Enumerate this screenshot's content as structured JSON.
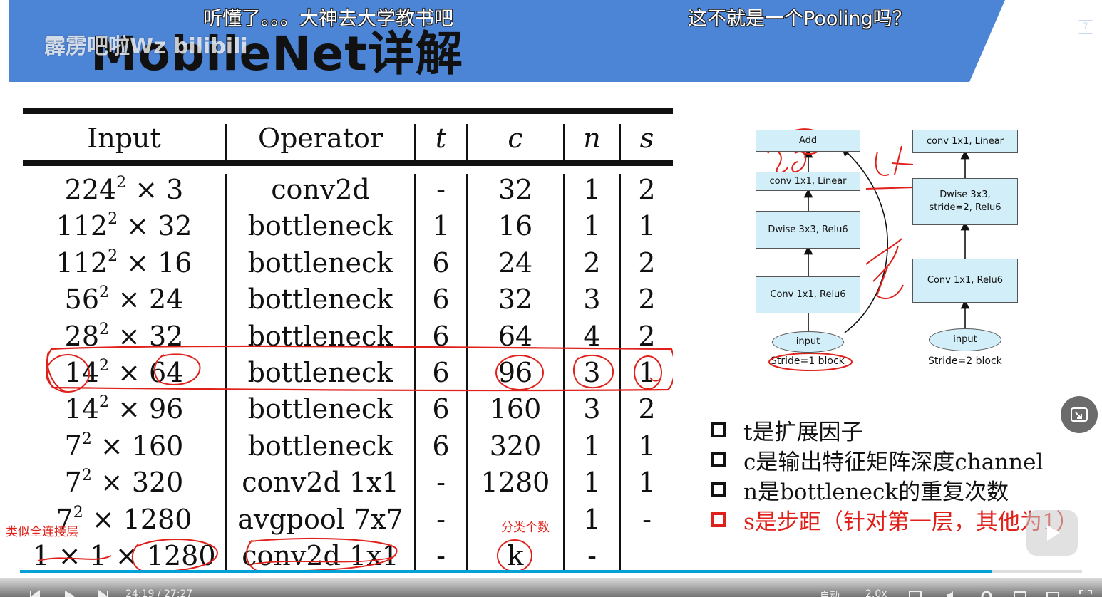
{
  "banner": {
    "title": "MobileNet详解",
    "watermark": "霹雳吧啦Wz bilibili",
    "danmaku": [
      "听懂了。。。大神去大学教书吧",
      "这不就是一个Pooling吗？"
    ],
    "help": "?",
    "color": "#4d85d6"
  },
  "table": {
    "headers": [
      "Input",
      "Operator",
      "t",
      "c",
      "n",
      "s"
    ],
    "rows": [
      {
        "in_base": "224",
        "in_exp": "2",
        "in_rest": " × 3",
        "op": "conv2d",
        "t": "-",
        "c": "32",
        "n": "1",
        "s": "2"
      },
      {
        "in_base": "112",
        "in_exp": "2",
        "in_rest": " × 32",
        "op": "bottleneck",
        "t": "1",
        "c": "16",
        "n": "1",
        "s": "1"
      },
      {
        "in_base": "112",
        "in_exp": "2",
        "in_rest": " × 16",
        "op": "bottleneck",
        "t": "6",
        "c": "24",
        "n": "2",
        "s": "2"
      },
      {
        "in_base": "56",
        "in_exp": "2",
        "in_rest": " × 24",
        "op": "bottleneck",
        "t": "6",
        "c": "32",
        "n": "3",
        "s": "2"
      },
      {
        "in_base": "28",
        "in_exp": "2",
        "in_rest": " × 32",
        "op": "bottleneck",
        "t": "6",
        "c": "64",
        "n": "4",
        "s": "2"
      },
      {
        "in_base": "14",
        "in_exp": "2",
        "in_rest": " × 64",
        "op": "bottleneck",
        "t": "6",
        "c": "96",
        "n": "3",
        "s": "1"
      },
      {
        "in_base": "14",
        "in_exp": "2",
        "in_rest": " × 96",
        "op": "bottleneck",
        "t": "6",
        "c": "160",
        "n": "3",
        "s": "2"
      },
      {
        "in_base": "7",
        "in_exp": "2",
        "in_rest": " × 160",
        "op": "bottleneck",
        "t": "6",
        "c": "320",
        "n": "1",
        "s": "1"
      },
      {
        "in_base": "7",
        "in_exp": "2",
        "in_rest": " × 320",
        "op": "conv2d 1x1",
        "t": "-",
        "c": "1280",
        "n": "1",
        "s": "1"
      },
      {
        "in_base": "7",
        "in_exp": "2",
        "in_rest": " × 1280",
        "op": "avgpool 7x7",
        "t": "-",
        "c": "",
        "n": "1",
        "s": "-"
      },
      {
        "in_base": "1 × 1",
        "in_exp": "",
        "in_rest": " × 1280",
        "op": "conv2d 1x1",
        "t": "-",
        "c": "k",
        "n": "-",
        "s": ""
      }
    ]
  },
  "notes": {
    "left": "类似全连接层",
    "middle": "分类个数",
    "handwritten": [
      "96",
      "64"
    ]
  },
  "diagram": {
    "stride1": {
      "add": "Add",
      "linear": "conv 1x1, Linear",
      "dwise": "Dwise 3x3, Relu6",
      "conv": "Conv 1x1, Relu6",
      "input": "input",
      "label": "Stride=1 block"
    },
    "stride2": {
      "linear": "conv 1x1, Linear",
      "dwise_line1": "Dwise 3x3,",
      "dwise_line2": "stride=2, Relu6",
      "conv": "Conv 1x1, Relu6",
      "input": "input",
      "label": "Stride=2 block"
    }
  },
  "legend": [
    {
      "text": "t是扩展因子",
      "color": "#111111"
    },
    {
      "text": "c是输出特征矩阵深度channel",
      "color": "#111111"
    },
    {
      "text": "n是bottleneck的重复次数",
      "color": "#111111"
    },
    {
      "text": "s是步距（针对第一层，其他为1）",
      "color": "#e0201a"
    }
  ],
  "player": {
    "progress": 0.915,
    "time": "24:19 / 27:27",
    "autoplay_label": "自动",
    "speed": "2.0x",
    "accent": "#00a1d6"
  }
}
